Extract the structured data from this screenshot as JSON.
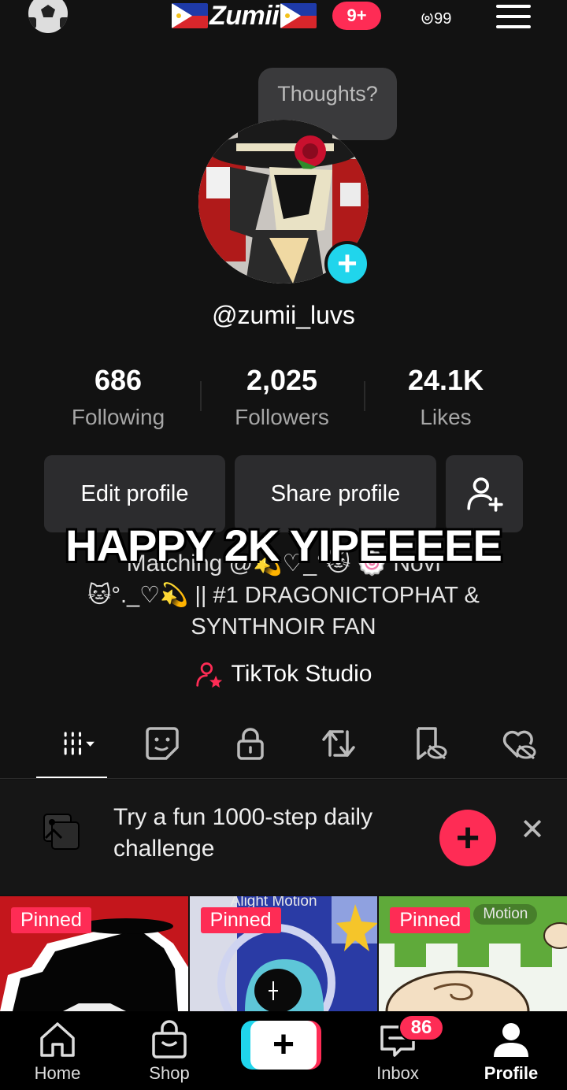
{
  "header": {
    "title": "Zumii",
    "notification_count": "9+",
    "glyph_main": "ၑ",
    "glyph_sub": "99"
  },
  "profile": {
    "bubble_text": "Thoughts?",
    "avatar_add": "+",
    "username": "@zumii_luvs"
  },
  "stats": [
    {
      "value": "686",
      "label": "Following"
    },
    {
      "value": "2,025",
      "label": "Followers"
    },
    {
      "value": "24.1K",
      "label": "Likes"
    }
  ],
  "buttons": {
    "edit": "Edit profile",
    "share": "Share profile"
  },
  "overlay_caption": "HAPPY 2K YIPEEEEE",
  "bio": {
    "line1_partial": "Matching  @💫♡_°🐱 🍥 Novi",
    "line2": "🐱°._♡💫 || #1 DRAGONICTOPHAT &",
    "line3": "SYNTHNOIR FAN"
  },
  "studio_label": "TikTok Studio",
  "challenge": {
    "text": "Try a fun 1000-step daily challenge",
    "add": "+",
    "close": "✕"
  },
  "thumbnails": [
    {
      "pinned": "Pinned",
      "watermark": ""
    },
    {
      "pinned": "Pinned",
      "watermark": "Alight Motion"
    },
    {
      "pinned": "Pinned",
      "watermark": "Motion"
    }
  ],
  "nav": {
    "home": "Home",
    "shop": "Shop",
    "create": "+",
    "inbox": "Inbox",
    "inbox_badge": "86",
    "profile": "Profile"
  },
  "colors": {
    "accent_red": "#fe2c55",
    "accent_cyan": "#20d5ec",
    "background": "#121212"
  }
}
